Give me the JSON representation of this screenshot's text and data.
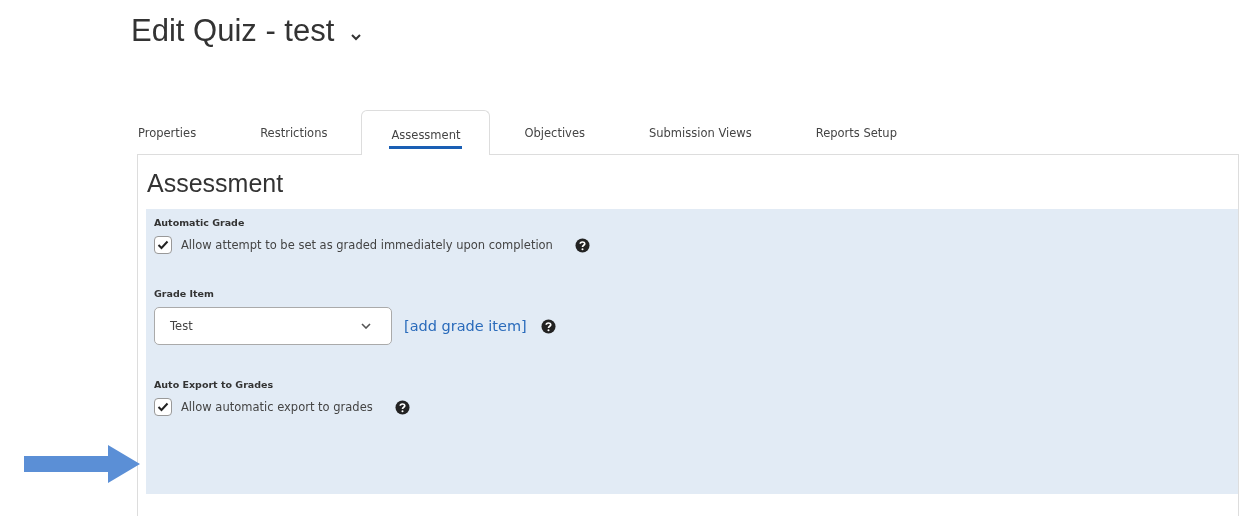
{
  "page_title": "Edit Quiz - test",
  "tabs": [
    {
      "label": "Properties",
      "selected": false
    },
    {
      "label": "Restrictions",
      "selected": false
    },
    {
      "label": "Assessment",
      "selected": true
    },
    {
      "label": "Objectives",
      "selected": false
    },
    {
      "label": "Submission Views",
      "selected": false
    },
    {
      "label": "Reports Setup",
      "selected": false
    }
  ],
  "heading": "Assessment",
  "sections": [
    {
      "kind": "checkbox",
      "label": "Automatic Grade",
      "text": "Allow attempt to be set as graded immediately upon completion",
      "checked": true
    },
    {
      "kind": "select",
      "label": "Grade Item",
      "value": "Test",
      "link": "[add grade item]"
    },
    {
      "kind": "checkbox",
      "label": "Auto Export to Grades",
      "text": "Allow automatic export to grades",
      "checked": true
    }
  ]
}
